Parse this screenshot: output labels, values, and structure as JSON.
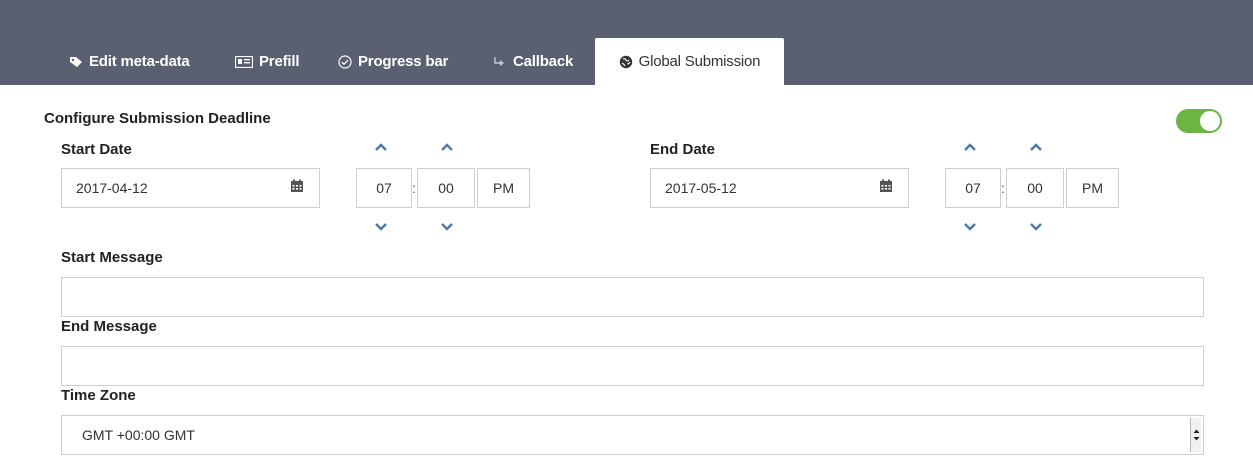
{
  "tabs": [
    {
      "label": "Edit meta-data",
      "icon": "tag-icon"
    },
    {
      "label": "Prefill",
      "icon": "id-card-icon"
    },
    {
      "label": "Progress bar",
      "icon": "check-circle-icon"
    },
    {
      "label": "Callback",
      "icon": "callback-icon"
    },
    {
      "label": "Global Submission",
      "icon": "globe-icon",
      "active": true
    }
  ],
  "section": {
    "title": "Configure Submission Deadline",
    "enabled": true
  },
  "start": {
    "label": "Start Date",
    "date": "2017-04-12",
    "hour": "07",
    "minute": "00",
    "meridian": "PM"
  },
  "end": {
    "label": "End Date",
    "date": "2017-05-12",
    "hour": "07",
    "minute": "00",
    "meridian": "PM"
  },
  "time_separator": ":",
  "start_message": {
    "label": "Start Message",
    "value": ""
  },
  "end_message": {
    "label": "End Message",
    "value": ""
  },
  "timezone": {
    "label": "Time Zone",
    "value": "GMT +00:00 GMT"
  },
  "colors": {
    "header": "#5b5f72",
    "toggle": "#6cb545",
    "arrow": "#4a78ad"
  }
}
